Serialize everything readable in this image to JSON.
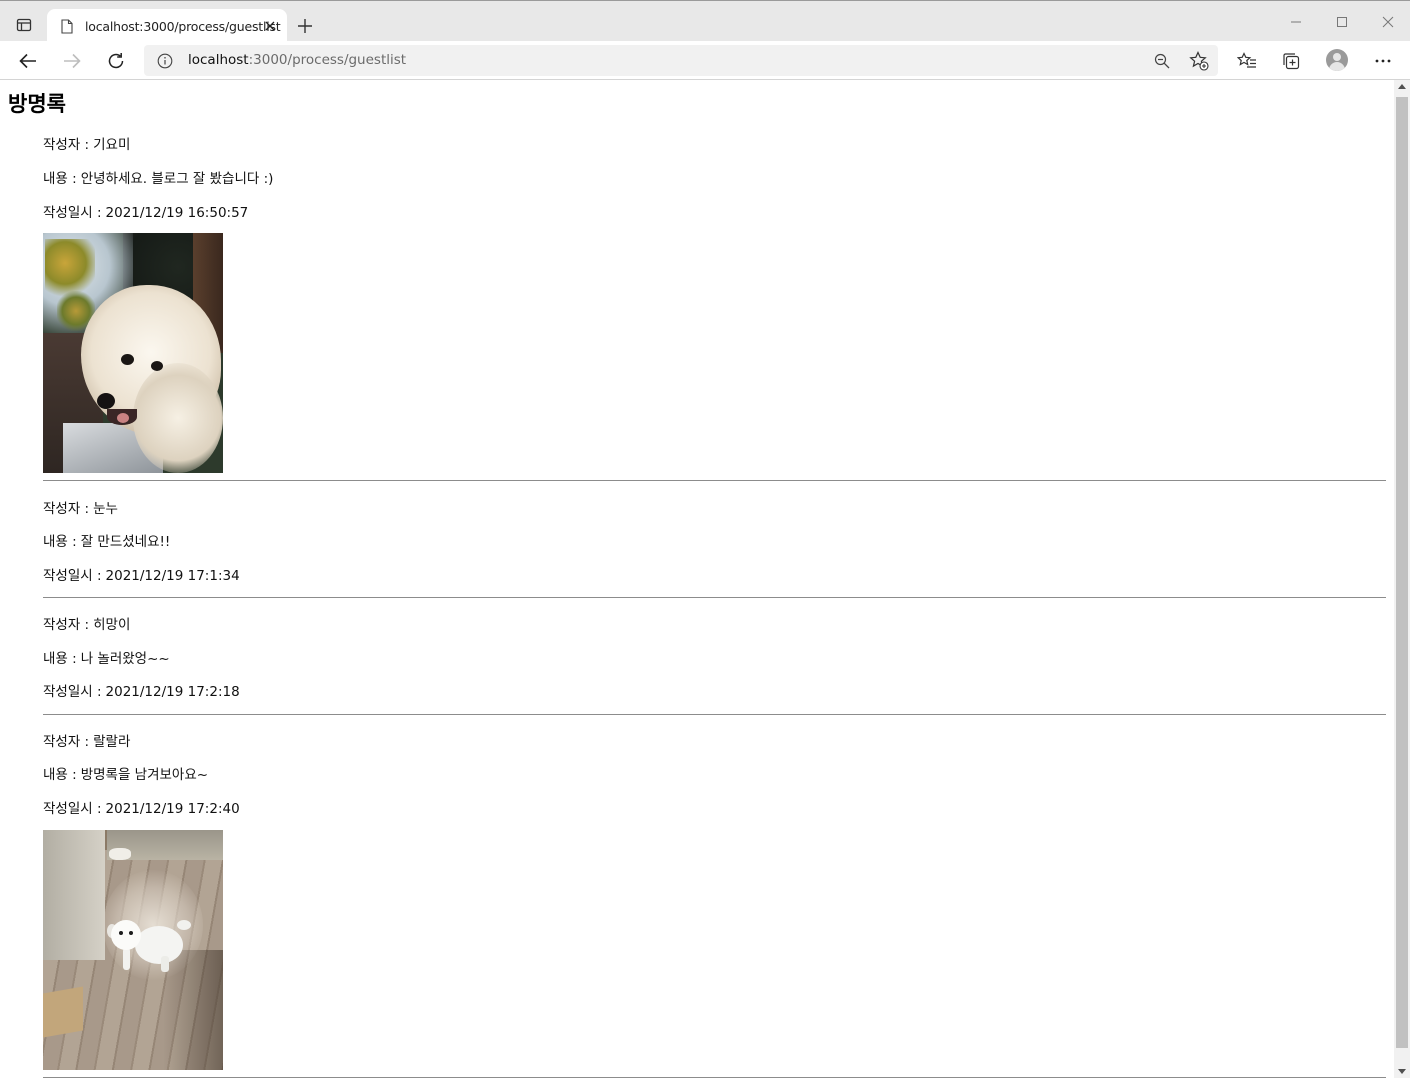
{
  "browser": {
    "tab_title": "localhost:3000/process/guestlist",
    "url_host": "localhost",
    "url_rest": ":3000/process/guestlist"
  },
  "page": {
    "title": "방명록"
  },
  "labels": {
    "author": "작성자 :",
    "content": "내용 :",
    "date": "작성일시 :"
  },
  "entries": [
    {
      "author": "기요미",
      "content": "안녕하세요. 블로그 잘 봤습니다 :)",
      "date": "2021/12/19 16:50:57",
      "has_photo": true
    },
    {
      "author": "눈누",
      "content": "잘 만드셨네요!!",
      "date": "2021/12/19 17:1:34",
      "has_photo": false
    },
    {
      "author": "히망이",
      "content": "나 놀러왔엉~~",
      "date": "2021/12/19 17:2:18",
      "has_photo": false
    },
    {
      "author": "랄랄라",
      "content": "방명록을 남겨보아요~",
      "date": "2021/12/19 17:2:40",
      "has_photo": true
    }
  ],
  "icons": {
    "tab_actions": "tab-actions-icon",
    "page": "page-icon",
    "close": "close-icon",
    "new_tab": "plus-icon",
    "minimize": "minimize-icon",
    "maximize": "maximize-icon",
    "window_close": "window-close-icon",
    "back": "back-arrow-icon",
    "forward": "forward-arrow-icon",
    "refresh": "refresh-icon",
    "info": "info-icon",
    "zoom": "zoom-out-icon",
    "add_favorite": "star-plus-icon",
    "favorites": "favorites-icon",
    "collections": "collections-icon",
    "profile": "profile-icon",
    "more": "more-icon"
  }
}
